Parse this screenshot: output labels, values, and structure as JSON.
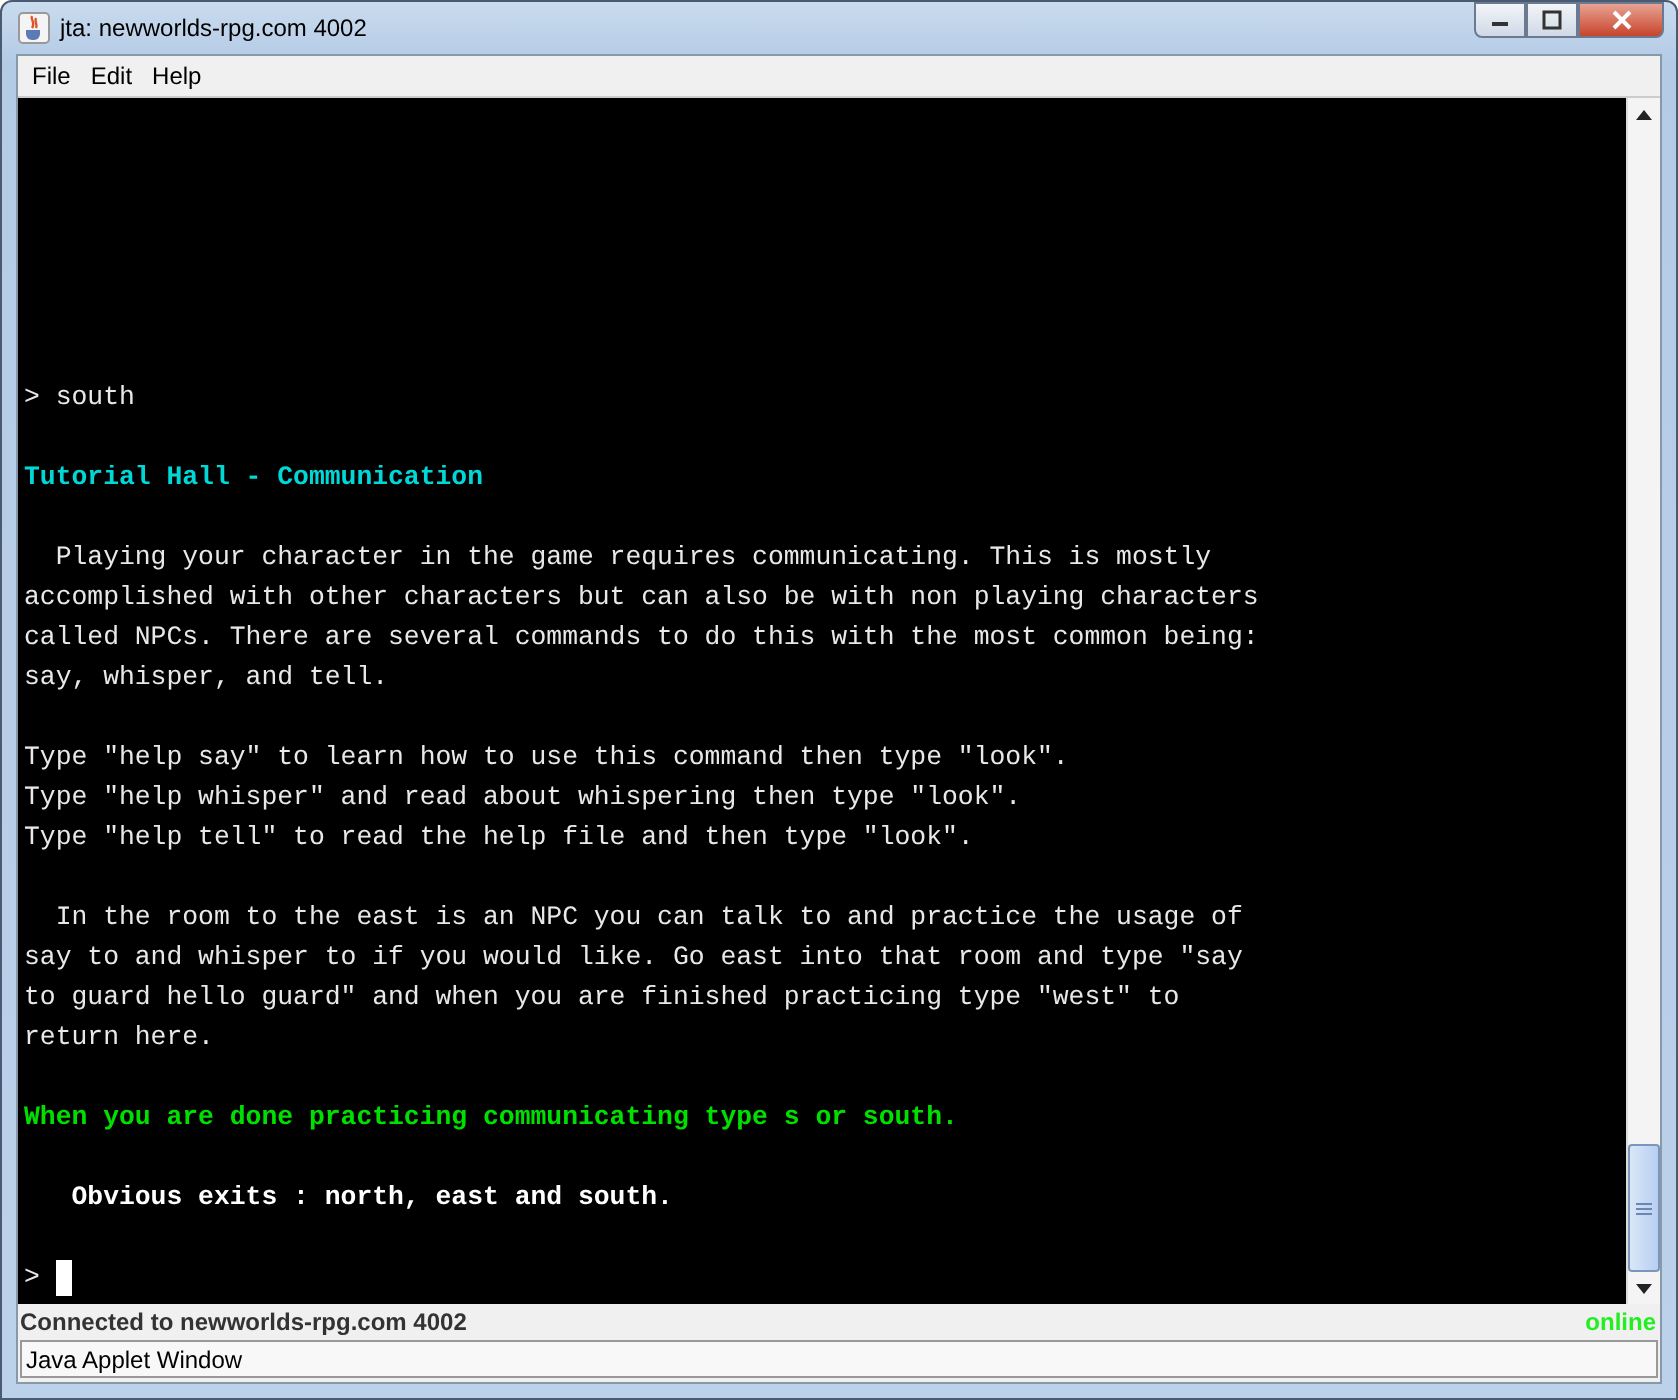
{
  "window": {
    "title": "jta: newworlds-rpg.com 4002"
  },
  "menu": [
    "File",
    "Edit",
    "Help"
  ],
  "terminal": {
    "lines": [
      {
        "kind": "plain",
        "text": "> south"
      },
      {
        "kind": "blank"
      },
      {
        "kind": "heading",
        "text": "Tutorial Hall - Communication"
      },
      {
        "kind": "blank"
      },
      {
        "kind": "plain",
        "text": "  Playing your character in the game requires communicating. This is mostly"
      },
      {
        "kind": "plain",
        "text": "accomplished with other characters but can also be with non playing characters"
      },
      {
        "kind": "plain",
        "text": "called NPCs. There are several commands to do this with the most common being:"
      },
      {
        "kind": "plain",
        "text": "say, whisper, and tell."
      },
      {
        "kind": "blank"
      },
      {
        "kind": "plain",
        "text": "Type \"help say\" to learn how to use this command then type \"look\"."
      },
      {
        "kind": "plain",
        "text": "Type \"help whisper\" and read about whispering then type \"look\"."
      },
      {
        "kind": "plain",
        "text": "Type \"help tell\" to read the help file and then type \"look\"."
      },
      {
        "kind": "blank"
      },
      {
        "kind": "plain",
        "text": "  In the room to the east is an NPC you can talk to and practice the usage of"
      },
      {
        "kind": "plain",
        "text": "say to and whisper to if you would like. Go east into that room and type \"say"
      },
      {
        "kind": "plain",
        "text": "to guard hello guard\" and when you are finished practicing type \"west\" to"
      },
      {
        "kind": "plain",
        "text": "return here."
      },
      {
        "kind": "blank"
      },
      {
        "kind": "notice",
        "text": "When you are done practicing communicating type s or south."
      },
      {
        "kind": "blank"
      },
      {
        "kind": "exits",
        "text": "   Obvious exits : north, east and south."
      },
      {
        "kind": "blank"
      },
      {
        "kind": "prompt",
        "text": ">"
      }
    ]
  },
  "status": {
    "text": "Connected to newworlds-rpg.com 4002",
    "state": "online"
  },
  "applet_bar": "Java Applet Window"
}
